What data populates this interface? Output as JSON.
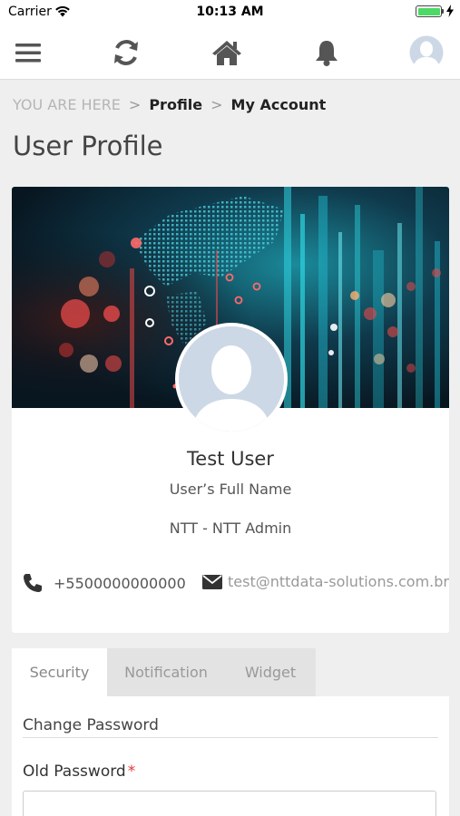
{
  "status_bar": {
    "carrier": "Carrier",
    "time": "10:13 AM",
    "battery_level": 1.0
  },
  "nav": {
    "icons": [
      "menu-icon",
      "refresh-icon",
      "home-icon",
      "bell-icon",
      "user-avatar-icon"
    ]
  },
  "breadcrumb": {
    "prefix": "YOU ARE HERE",
    "separator": ">",
    "items": [
      "Profile",
      "My Account"
    ]
  },
  "page": {
    "title": "User Profile"
  },
  "profile": {
    "name": "Test User",
    "full_name_label": "User’s Full Name",
    "organization": "NTT - NTT Admin",
    "phone": "+5500000000000",
    "email": "test@nttdata-solutions.com.br"
  },
  "tabs": [
    {
      "label": "Security",
      "active": true
    },
    {
      "label": "Notification",
      "active": false
    },
    {
      "label": "Widget",
      "active": false
    }
  ],
  "security": {
    "section_title": "Change Password",
    "old_password_label": "Old Password",
    "required_marker": "*",
    "old_password_value": ""
  },
  "colors": {
    "accent_required": "#e53935",
    "nav_icon": "#555555",
    "cover_dark": "#0b1d2a",
    "cover_cyan": "#1fb6c9",
    "cover_red": "#e84a4a"
  }
}
